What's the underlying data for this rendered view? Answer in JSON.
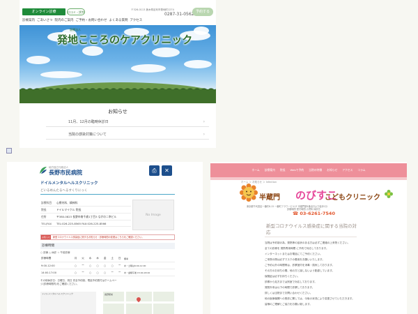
{
  "site1": {
    "logo_text": "オンライン診療",
    "badge": "口コミ・評判",
    "address": "〒326-0113 栃木県足利市発地町1274",
    "phone": "0287-31-0562",
    "reserve_label": "予約する",
    "nav": [
      "診療案内",
      "ごあいさつ",
      "院内のご案内",
      "ご予約・お問い合わせ",
      "よくある質問",
      "アクセス"
    ],
    "title_small": "医療法人",
    "title": "発地こころのケアクリニック",
    "news_title": "お知らせ",
    "news": [
      {
        "text": "11月、12月の臨時休診日"
      },
      {
        "text": "当院の感染対策について"
      }
    ]
  },
  "site2": {
    "logo_small": "地方独立行政法人",
    "logo_text": "長野市民病院",
    "print_icon": "printer-icon",
    "close_icon": "close-icon",
    "clinic_name": "ドイルメンタルヘルスクリニック",
    "subline": "どいるめんたるへるすくりにっく",
    "info": [
      {
        "k": "診療科目",
        "v": "心療内科、精神科"
      },
      {
        "k": "院長",
        "v": "ドイルマイケル 院長"
      },
      {
        "k": "住所",
        "v": "〒380-0823 長野市南千歳1丁目3 ながの二幸ビル"
      },
      {
        "k": "TEL/FAX",
        "v": "TEL:026-225-8565 FAX:026-225-8566"
      }
    ],
    "noimage": "No Image",
    "alert_tag": "お知らせ",
    "alert_text": "新型コロナウイルス感染症に関するお知らせ・診療時間の変更はこちらをご確認ください。",
    "hours_title": "診療時間",
    "legend": "○ 診療 △ 休診 ☆ 午前診療",
    "hours_header": [
      "診療時間",
      "月",
      "火",
      "水",
      "木",
      "金",
      "土",
      "日",
      "備考"
    ],
    "hours_rows": [
      [
        "9:00-12:00",
        "○",
        "ー",
        "○",
        "○",
        "○",
        "○",
        "ー",
        "水・土曜は9:00-12:00"
      ],
      [
        "14:00-17:00",
        "○",
        "ー",
        "○",
        "○",
        "○",
        "ー",
        "ー",
        "木・金曜午後 15:00-18:00"
      ]
    ],
    "note": "その他休診日：日曜日、祝日 完全予約制、電話予約受付はホームページ(診療時間内)をご確認ください。",
    "minimap_label": "ドイルメンタルヘルスクリニック",
    "map_label": "長野駅前"
  },
  "site3": {
    "nav": [
      "ホーム",
      "診療案内",
      "院長",
      "Webで予約",
      "当院の特徴",
      "お知らせ",
      "アクセス",
      "コラム"
    ],
    "breadcrumb": "ホーム ＞ お知らせ ＞ Infection",
    "logo_a": "半蔵門",
    "logo_b": "のびすこ",
    "logo_c": "こどもクリニック",
    "address1": "東京都千代田区一番町8-15 一番町フラワービル1F 半蔵門駅4番出口より徒歩1分",
    "address2": "診療時間 受付時間 小児科 休診日",
    "tel": "03-6261-7540",
    "heading": "新型コロナウイルス感染症に関する当院の対応",
    "paragraphs": [
      "当院は予約制の為、発熱等の症状のある方は必ずご連絡の上来院ください。",
      "全ての診療を 発熱専用時間 に予約で対応しております。",
      "インターネットまたはお電話にてご予約ください。",
      "ご来院の際は必ずマスクの着用をお願いいたします。",
      "ご予約以外の時間帯は、診察室内を消毒・換気しております。",
      "その方のお待ちの間、他の方と接しないよう配慮しています。",
      "保険証は必ずお持ちください。",
      "診察から処方までは別室で対応しております。",
      "発熱外来は以下の時間で診察しております。",
      "詳しくは当院までお問い合わせください。",
      "他の医療機関への受診に関しては、今後の状況により変更させていただきます。",
      "皆様のご理解とご協力をお願い致します。"
    ]
  }
}
